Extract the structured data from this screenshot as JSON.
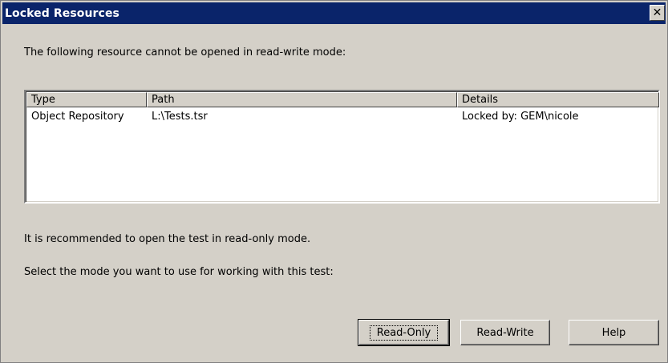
{
  "window": {
    "title": "Locked Resources",
    "close_label": "✕"
  },
  "message": {
    "intro": "The following resource cannot be opened in read-write mode:",
    "recommend": "It is recommended to open the test in read-only mode.",
    "select_mode": "Select the mode you want to use for working with this test:"
  },
  "table": {
    "columns": [
      "Type",
      "Path",
      "Details"
    ],
    "rows": [
      [
        "Object Repository",
        "L:\\Tests.tsr",
        "Locked by: GEM\\nicole"
      ]
    ]
  },
  "buttons": {
    "read_only": "Read-Only",
    "read_write": "Read-Write",
    "help": "Help"
  },
  "colors": {
    "titlebar": "#0a246a",
    "face": "#d4d0c8"
  }
}
